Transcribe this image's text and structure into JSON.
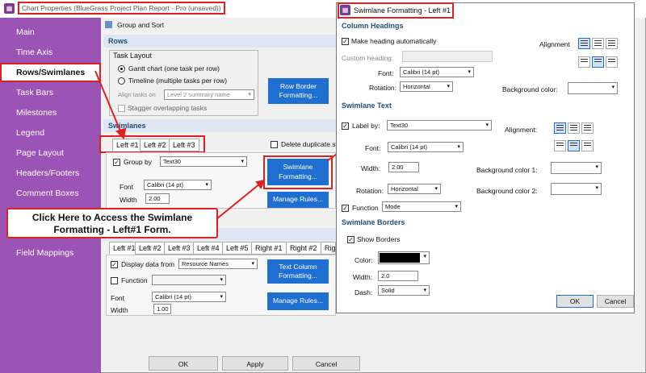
{
  "main_window": {
    "title": "Chart Properties (BlueGrass Project Plan Report - Pro (unsaved))",
    "sidebar": [
      "Main",
      "Time Axis",
      "Rows/Swimlanes",
      "Task Bars",
      "Milestones",
      "Legend",
      "Page Layout",
      "Headers/Footers",
      "Comment Boxes",
      "",
      "Field Mappings"
    ],
    "group_sort_label": "Group and Sort",
    "rows": {
      "header": "Rows",
      "task_layout_label": "Task Layout",
      "gantt_option": "Gantt chart (one task per row)",
      "timeline_option": "Timeline (multiple tasks per row)",
      "align_tasks_label": "Align tasks on",
      "align_tasks_value": "Level 2 summary name",
      "stagger_label": "Stagger overlapping tasks",
      "row_border_button": "Row Border Formatting..."
    },
    "swimlanes": {
      "header": "Swimlanes",
      "tabs": [
        "Left #1",
        "Left #2",
        "Left #3"
      ],
      "delete_duplicate_label": "Delete duplicate sw",
      "group_by_label": "Group by",
      "group_by_value": "Text30",
      "font_label": "Font",
      "font_value": "Calibri (14 pt)",
      "width_label": "Width",
      "width_value": "2.00",
      "swimlane_formatting_button": "Swimlane Formatting...",
      "manage_rules_button": "Manage Rules..."
    },
    "columns": {
      "tabs": [
        "Left #1",
        "Left #2",
        "Left #3",
        "Left #4",
        "Left #5",
        "Right #1",
        "Right #2",
        "Righ"
      ],
      "display_data_label": "Display data from",
      "display_data_value": "Resource Names",
      "function_label": "Function",
      "font_label": "Font",
      "font_value": "Calibri (14 pt)",
      "width_label": "Width",
      "width_value": "1.00",
      "text_column_button": "Text Column Formatting...",
      "manage_rules_button": "Manage Rules..."
    },
    "buttons": {
      "ok": "OK",
      "apply": "Apply",
      "cancel": "Cancel"
    }
  },
  "callout": {
    "line1": "Click Here to Access the Swimlane",
    "line2": "Formatting - Left#1 Form."
  },
  "dialog": {
    "title": "Swimlane Formatting - Left #1",
    "column_headings": {
      "header": "Column Headings",
      "make_heading_label": "Make heading automatically",
      "custom_heading_label": "Custom heading:",
      "font_label": "Font:",
      "font_value": "Calibri (14 pt)",
      "rotation_label": "Rotation:",
      "rotation_value": "Horizontal",
      "alignment_label": "Alignment",
      "background_label": "Background color:"
    },
    "swimlane_text": {
      "header": "Swimlane Text",
      "label_by_label": "Label by:",
      "label_by_value": "Text30",
      "font_label": "Font:",
      "font_value": "Calibri (14 pt)",
      "width_label": "Width:",
      "width_value": "2.00",
      "rotation_label": "Rotation:",
      "rotation_value": "Horizontal",
      "function_label": "Function",
      "function_value": "Mode",
      "alignment_label": "Alignment:",
      "bg1_label": "Background color 1:",
      "bg2_label": "Background color 2:"
    },
    "swimlane_borders": {
      "header": "Swimlane Borders",
      "show_borders_label": "Show Borders",
      "color_label": "Color:",
      "color_value": "#000000",
      "width_label": "Width:",
      "width_value": "2.0",
      "dash_label": "Dash:",
      "dash_value": "Solid"
    },
    "ok": "OK",
    "cancel": "Cancel"
  },
  "colors": {
    "sidebar": "#9b54b5",
    "accent_blue": "#1e6fd0",
    "highlight_red": "#e02020"
  },
  "icons": [
    "window-app-icon",
    "dropdown-arrow-icon",
    "align-icon",
    "checkbox-check-icon"
  ]
}
